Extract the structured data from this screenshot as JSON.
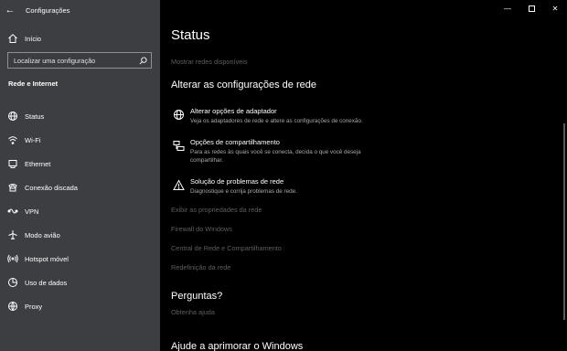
{
  "app": {
    "title": "Configurações"
  },
  "sidebar": {
    "home_label": "Início",
    "search_placeholder": "Localizar uma configuração",
    "section_title": "Rede e Internet",
    "items": [
      {
        "label": "Status",
        "icon": "globe-icon"
      },
      {
        "label": "Wi-Fi",
        "icon": "wifi-icon"
      },
      {
        "label": "Ethernet",
        "icon": "ethernet-icon"
      },
      {
        "label": "Conexão discada",
        "icon": "dialup-icon"
      },
      {
        "label": "VPN",
        "icon": "vpn-icon"
      },
      {
        "label": "Modo avião",
        "icon": "airplane-icon"
      },
      {
        "label": "Hotspot móvel",
        "icon": "hotspot-icon"
      },
      {
        "label": "Uso de dados",
        "icon": "data-usage-icon"
      },
      {
        "label": "Proxy",
        "icon": "proxy-icon"
      }
    ]
  },
  "main": {
    "title": "Status",
    "show_networks": "Mostrar redes disponíveis",
    "change_heading": "Alterar as configurações de rede",
    "options": [
      {
        "title": "Alterar opções de adaptador",
        "desc": "Veja os adaptadores de rede e altere as configurações de conexão.",
        "icon": "adapter-icon"
      },
      {
        "title": "Opções de compartilhamento",
        "desc": "Para as redes às quais você se conecta, decida o que você deseja compartilhar.",
        "icon": "sharing-icon"
      },
      {
        "title": "Solução de problemas de rede",
        "desc": "Diagnostique e corrija problemas de rede.",
        "icon": "warning-icon"
      }
    ],
    "links": [
      "Exibir as propriedades da rede",
      "Firewall do Windows",
      "Central de Rede e Compartilhamento",
      "Redefinição da rede"
    ],
    "questions_heading": "Perguntas?",
    "get_help": "Obtenha ajuda",
    "improve_heading": "Ajude a aprimorar o Windows"
  }
}
